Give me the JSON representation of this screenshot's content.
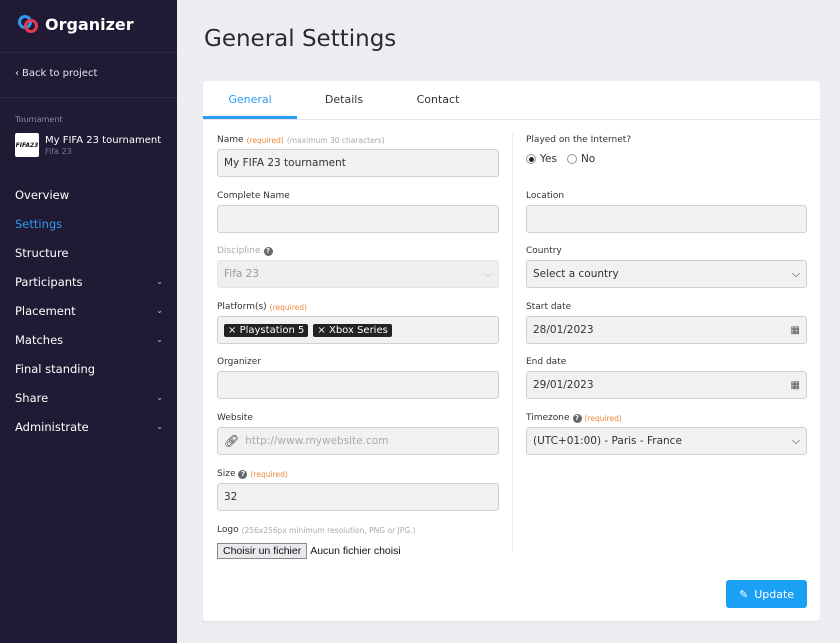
{
  "app": {
    "name": "Organizer"
  },
  "sidebar": {
    "back_label": "Back to project",
    "section_label": "Tournament",
    "tournament": {
      "name": "My FIFA 23 tournament",
      "game": "Fifa 23",
      "thumb_text": "FIFA23"
    },
    "items": [
      {
        "label": "Overview",
        "has_submenu": false,
        "active": false
      },
      {
        "label": "Settings",
        "has_submenu": false,
        "active": true
      },
      {
        "label": "Structure",
        "has_submenu": false,
        "active": false
      },
      {
        "label": "Participants",
        "has_submenu": true,
        "active": false
      },
      {
        "label": "Placement",
        "has_submenu": true,
        "active": false
      },
      {
        "label": "Matches",
        "has_submenu": true,
        "active": false
      },
      {
        "label": "Final standing",
        "has_submenu": false,
        "active": false
      },
      {
        "label": "Share",
        "has_submenu": true,
        "active": false
      },
      {
        "label": "Administrate",
        "has_submenu": true,
        "active": false
      }
    ]
  },
  "page": {
    "title": "General Settings"
  },
  "tabs": [
    {
      "label": "General",
      "active": true
    },
    {
      "label": "Details",
      "active": false
    },
    {
      "label": "Contact",
      "active": false
    }
  ],
  "form": {
    "required_text": "(required)",
    "name": {
      "label": "Name",
      "hint": "(maximum 30 characters)",
      "value": "My FIFA 23 tournament"
    },
    "complete_name": {
      "label": "Complete Name",
      "value": ""
    },
    "discipline": {
      "label": "Discipline",
      "value": "Fifa 23"
    },
    "platforms": {
      "label": "Platform(s)",
      "tags": [
        "Playstation 5",
        "Xbox Series"
      ]
    },
    "organizer": {
      "label": "Organizer",
      "value": ""
    },
    "website": {
      "label": "Website",
      "placeholder": "http://www.mywebsite.com"
    },
    "size": {
      "label": "Size",
      "value": "32"
    },
    "logo": {
      "label": "Logo",
      "hint": "(256x256px minimum resolution, PNG or JPG.)",
      "button": "Choisir un fichier",
      "status": "Aucun fichier choisi"
    },
    "online": {
      "label": "Played on the Internet?",
      "options": [
        "Yes",
        "No"
      ],
      "selected": "Yes"
    },
    "location": {
      "label": "Location",
      "value": ""
    },
    "country": {
      "label": "Country",
      "value": "Select a country"
    },
    "start_date": {
      "label": "Start date",
      "value": "28/01/2023"
    },
    "end_date": {
      "label": "End date",
      "value": "29/01/2023"
    },
    "timezone": {
      "label": "Timezone",
      "value": "(UTC+01:00) - Paris - France"
    },
    "submit_label": "Update"
  },
  "colors": {
    "accent": "#2c9bf0",
    "sidebar_bg": "#201a34",
    "required": "#f0883a",
    "button": "#1aa0f5"
  }
}
